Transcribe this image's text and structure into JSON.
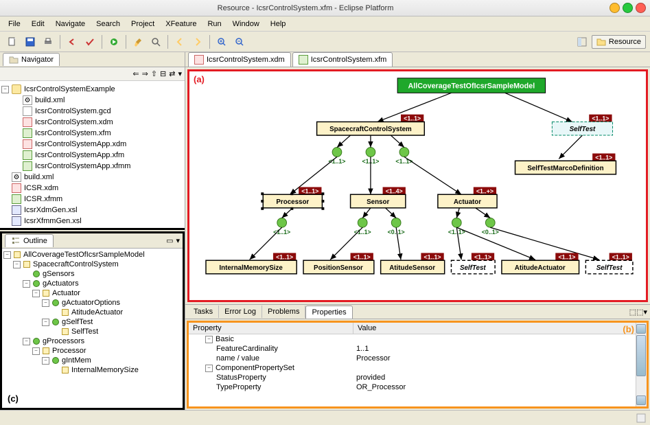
{
  "window": {
    "title": "Resource - IcsrControlSystem.xfm - Eclipse Platform"
  },
  "menu": {
    "items": [
      "File",
      "Edit",
      "Navigate",
      "Search",
      "Project",
      "XFeature",
      "Run",
      "Window",
      "Help"
    ]
  },
  "perspective": {
    "label": "Resource"
  },
  "navigator": {
    "title": "Navigator",
    "root": "IcsrControlSystemExample",
    "files": [
      {
        "name": "build.xml",
        "type": "ant"
      },
      {
        "name": "IcsrControlSystem.gcd",
        "type": "file"
      },
      {
        "name": "IcsrControlSystem.xdm",
        "type": "xdm"
      },
      {
        "name": "IcsrControlSystem.xfm",
        "type": "xfm"
      },
      {
        "name": "IcsrControlSystemApp.xdm",
        "type": "xdm"
      },
      {
        "name": "IcsrControlSystemApp.xfm",
        "type": "xfm"
      },
      {
        "name": "IcsrControlSystemApp.xfmm",
        "type": "xfm"
      }
    ],
    "more": [
      {
        "name": "build.xml",
        "type": "ant"
      },
      {
        "name": "ICSR.xdm",
        "type": "xdm"
      },
      {
        "name": "ICSR.xfmm",
        "type": "xfm"
      },
      {
        "name": "IcsrXdmGen.xsl",
        "type": "xsl"
      },
      {
        "name": "IcsrXfmmGen.xsl",
        "type": "xsl"
      }
    ]
  },
  "outline": {
    "title": "Outline",
    "root": "AllCoverageTestOfIcsrSampleModel",
    "tree": [
      {
        "label": "SpacecraftControlSystem",
        "type": "sq",
        "children": [
          {
            "label": "gSensors",
            "type": "dot"
          },
          {
            "label": "gActuators",
            "type": "dot",
            "children": [
              {
                "label": "Actuator",
                "type": "sq",
                "children": [
                  {
                    "label": "gActuatorOptions",
                    "type": "dot",
                    "children": [
                      {
                        "label": "AtitudeActuator",
                        "type": "sq"
                      }
                    ]
                  },
                  {
                    "label": "gSelfTest",
                    "type": "dot",
                    "children": [
                      {
                        "label": "SelfTest",
                        "type": "sq"
                      }
                    ]
                  }
                ]
              }
            ]
          },
          {
            "label": "gProcessors",
            "type": "dot",
            "children": [
              {
                "label": "Processor",
                "type": "sq",
                "children": [
                  {
                    "label": "gIntMem",
                    "type": "dot",
                    "children": [
                      {
                        "label": "InternalMemorySize",
                        "type": "sq"
                      }
                    ]
                  }
                ]
              }
            ]
          }
        ]
      }
    ],
    "label": "(c)"
  },
  "editor": {
    "tabs": [
      {
        "label": "IcsrControlSystem.xdm",
        "icon": "xdm"
      },
      {
        "label": "IcsrControlSystem.xfm",
        "icon": "xfm",
        "active": true
      }
    ],
    "label": "(a)",
    "nodes": {
      "root": "AllCoverageTestOfIcsrSampleModel",
      "scs": "SpacecraftControlSystem",
      "selftest": "SelfTest",
      "selftestmarco": "SelfTestMarcoDefinition",
      "processor": "Processor",
      "sensor": "Sensor",
      "actuator": "Actuator",
      "ims": "InternalMemorySize",
      "pos": "PositionSensor",
      "att": "AtitudeSensor",
      "selftest2": "SelfTest",
      "attact": "AtitudeActuator",
      "selftest3": "SelfTest"
    },
    "cards": {
      "c11": "<1..1>",
      "c14": "<1..4>",
      "c1p": "<1..+>",
      "c01": "<0..1>"
    }
  },
  "bottom": {
    "tabs": [
      "Tasks",
      "Error Log",
      "Problems",
      "Properties"
    ],
    "active": "Properties",
    "label": "(b)"
  },
  "properties": {
    "header": {
      "c1": "Property",
      "c2": "Value"
    },
    "rows": [
      {
        "k": "Basic",
        "v": "",
        "group": true
      },
      {
        "k": "FeatureCardinality",
        "v": "1..1",
        "indent": 2
      },
      {
        "k": "name / value",
        "v": "Processor",
        "indent": 2
      },
      {
        "k": "ComponentPropertySet",
        "v": "",
        "group": true
      },
      {
        "k": "StatusProperty",
        "v": "provided",
        "indent": 2
      },
      {
        "k": "TypeProperty",
        "v": "OR_Processor",
        "indent": 2
      }
    ]
  }
}
